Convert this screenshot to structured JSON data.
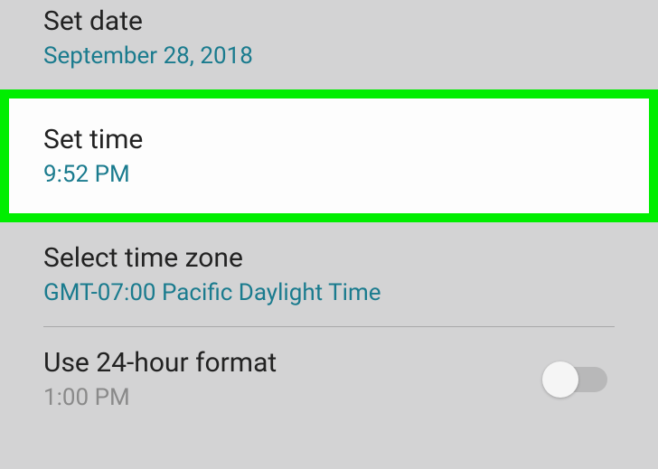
{
  "settings": {
    "set_date": {
      "title": "Set date",
      "value": "September 28, 2018"
    },
    "set_time": {
      "title": "Set time",
      "value": "9:52 PM"
    },
    "time_zone": {
      "title": "Select time zone",
      "value": "GMT-07:00 Pacific Daylight Time"
    },
    "hour_format": {
      "title": "Use 24-hour format",
      "value": "1:00 PM",
      "toggled": false
    }
  }
}
